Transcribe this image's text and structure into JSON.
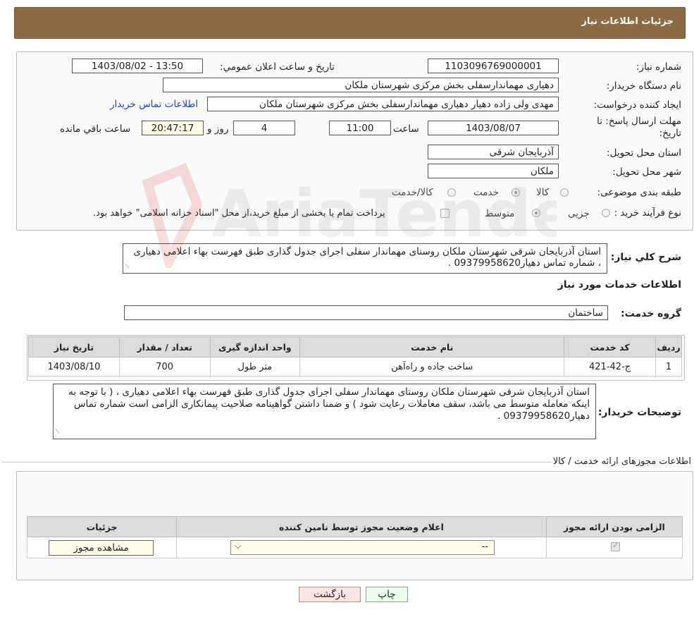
{
  "header": {
    "title": "جزئیات اطلاعات نیاز"
  },
  "form": {
    "need_number_label": "شماره نیاز:",
    "need_number": "1103096769000001",
    "announce_label": "تاریخ و ساعت اعلان عمومي:",
    "announce_value": "1403/08/02 - 13:50",
    "buyer_org_label": "نام دستگاه خریدار:",
    "buyer_org": "دهیاری مهماندارسفلی بخش مرکزی شهرستان ملکان",
    "creator_label": "ایجاد کننده درخواست:",
    "creator": "مهدی ولی زاده دهیار دهیاری مهماندارسفلی بخش مرکزی شهرستان ملکان",
    "buyer_contact_link": "اطلاعات تماس خریدار",
    "deadline_label": "مهلت ارسال پاسخ: تا تاریخ:",
    "deadline_date": "1403/08/07",
    "time_label": "ساعت",
    "deadline_time": "11:00",
    "days_value": "4",
    "days_label": "روز و",
    "remaining_time": "20:47:17",
    "remaining_label": "ساعت باقي مانده",
    "province_label": "استان محل تحویل:",
    "province": "آذربایجان شرقی",
    "city_label": "شهر محل تحویل:",
    "city": "ملکان",
    "category_label": "طبقه بندی موضوعی:",
    "category_options": [
      "کالا",
      "خدمت",
      "کالا/خدمت"
    ],
    "category_selected": "خدمت",
    "process_label": "نوع فرآیند خرید :",
    "process_options": [
      "جزیی",
      "متوسط"
    ],
    "process_selected": "متوسط",
    "payment_note": "پرداخت تمام یا بخشی از مبلغ خرید،از محل \"اسناد خزانه اسلامی\" خواهد بود."
  },
  "summary": {
    "label": "شرح کلي نياز:",
    "text": "استان آذربایجان شرقی شهرستان ملکان روستای مهماندار سفلی اجرای جدول گذاری طبق فهرست بهاء اعلامی دهیاری ، شماره تماس دهیار09379958620 ."
  },
  "services": {
    "section_title": "اطلاعات خدمات مورد نیاز",
    "group_label": "گروه خدمت:",
    "group_value": "ساختمان",
    "columns": [
      "ردیف",
      "کد خدمت",
      "نام خدمت",
      "واحد اندازه گیری",
      "تعداد / مقدار",
      "تاریخ نیاز"
    ],
    "rows": [
      {
        "index": "1",
        "code": "ج-42-421",
        "name": "ساخت جاده و راه‌آهن",
        "unit": "متر طول",
        "qty": "700",
        "date": "1403/08/10"
      }
    ]
  },
  "buyer_notes": {
    "label": "توضیحات خریدار:",
    "text": "استان آذربایجان شرقی شهرستان ملکان روستای مهماندار سفلی اجرای جدول گذاری طبق فهرست بهاء اعلامی دهیاری ، ( با توجه به اینکه معامله متوسط می باشد، سقف معاملات رعایت شود ) و ضمنا داشتن گواهینامه صلاحیت پیمانکاری الزامی است شماره تماس دهیار09379958620 ."
  },
  "permits": {
    "section_title": "اطلاعات مجوزهای ارائه خدمت / کالا",
    "columns": [
      "الزامی بودن ارائه مجوز",
      "اعلام وضعیت مجوز توسط نامین کننده",
      "جزئیات"
    ],
    "select_value": "--",
    "view_button": "مشاهده مجوز"
  },
  "actions": {
    "print": "چاپ",
    "back": "بازگشت"
  },
  "watermark": {
    "text": "AriaTender.neT"
  },
  "colors": {
    "header_bg": "#8b6a44",
    "link": "#1a3fd6",
    "back_btn_bg": "#ffe4e4",
    "print_btn_bg": "#eaffea"
  }
}
